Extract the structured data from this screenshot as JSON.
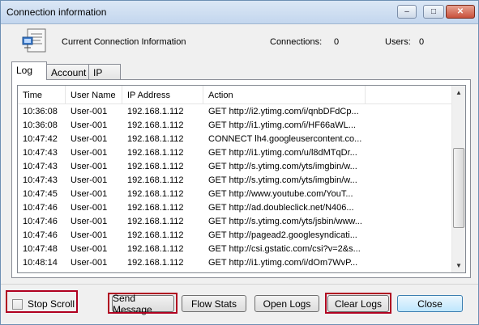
{
  "window": {
    "title": "Connection information",
    "controls": {
      "minimize": "–",
      "maximize": "□",
      "close": "✕"
    }
  },
  "header": {
    "icon": "connection-info-icon",
    "label": "Current Connection Information",
    "connections_label": "Connections:",
    "connections_value": "0",
    "users_label": "Users:",
    "users_value": "0"
  },
  "tabs": [
    {
      "label": "Log",
      "active": true
    },
    {
      "label": "Account",
      "active": false
    },
    {
      "label": "IP",
      "active": false
    }
  ],
  "log": {
    "columns": [
      "Time",
      "User Name",
      "IP Address",
      "Action"
    ],
    "rows": [
      [
        "10:36:08",
        "User-001",
        "192.168.1.112",
        "GET http://i2.ytimg.com/i/qnbDFdCp..."
      ],
      [
        "10:36:08",
        "User-001",
        "192.168.1.112",
        "GET http://i1.ytimg.com/i/HF66aWL..."
      ],
      [
        "10:47:42",
        "User-001",
        "192.168.1.112",
        "CONNECT lh4.googleusercontent.co..."
      ],
      [
        "10:47:43",
        "User-001",
        "192.168.1.112",
        "GET http://i1.ytimg.com/u/l8dMTqDr..."
      ],
      [
        "10:47:43",
        "User-001",
        "192.168.1.112",
        "GET http://s.ytimg.com/yts/imgbin/w..."
      ],
      [
        "10:47:43",
        "User-001",
        "192.168.1.112",
        "GET http://s.ytimg.com/yts/imgbin/w..."
      ],
      [
        "10:47:45",
        "User-001",
        "192.168.1.112",
        "GET http://www.youtube.com/YouT..."
      ],
      [
        "10:47:46",
        "User-001",
        "192.168.1.112",
        "GET http://ad.doubleclick.net/N406..."
      ],
      [
        "10:47:46",
        "User-001",
        "192.168.1.112",
        "GET http://s.ytimg.com/yts/jsbin/www..."
      ],
      [
        "10:47:46",
        "User-001",
        "192.168.1.112",
        "GET http://pagead2.googlesyndicati..."
      ],
      [
        "10:47:48",
        "User-001",
        "192.168.1.112",
        "GET http://csi.gstatic.com/csi?v=2&s..."
      ],
      [
        "10:48:14",
        "User-001",
        "192.168.1.112",
        "GET http://i1.ytimg.com/i/dOm7WvP..."
      ]
    ]
  },
  "footer": {
    "stop_scroll_label": "Stop Scroll",
    "stop_scroll_checked": false,
    "buttons": {
      "send_message": "Send Message",
      "flow_stats": "Flow Stats",
      "open_logs": "Open Logs",
      "clear_logs": "Clear Logs",
      "close": "Close"
    }
  },
  "colors": {
    "highlight_border": "#b00020"
  }
}
